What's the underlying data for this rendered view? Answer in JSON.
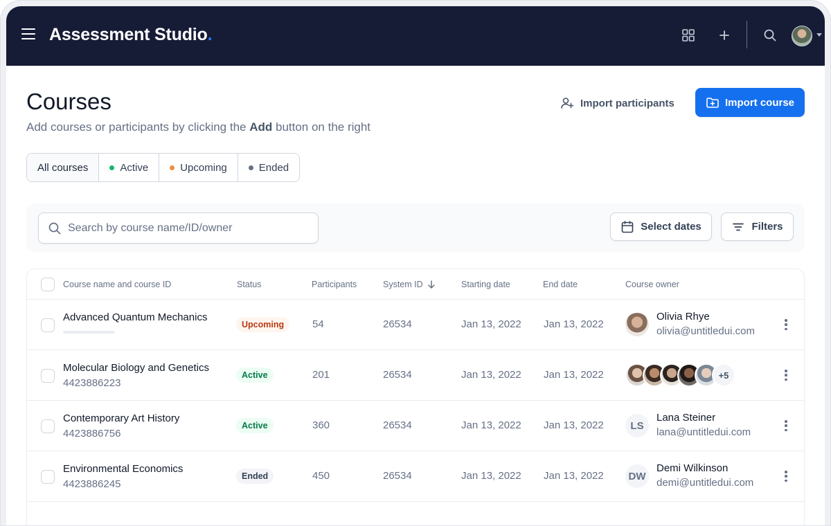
{
  "app": {
    "title": "Assessment Studio",
    "title_dot": "."
  },
  "header": {
    "title": "Courses",
    "subtitle_before": "Add courses or participants by clicking the ",
    "subtitle_bold": "Add",
    "subtitle_after": " button on the right",
    "import_participants": "Import participants",
    "import_course": "Import course"
  },
  "segments": [
    {
      "label": "All courses",
      "dot": null
    },
    {
      "label": "Active",
      "dot": "#12b76a"
    },
    {
      "label": "Upcoming",
      "dot": "#ef8c3c"
    },
    {
      "label": "Ended",
      "dot": "#667085"
    }
  ],
  "search": {
    "placeholder": "Search by course name/ID/owner",
    "value": ""
  },
  "filters": {
    "dates_label": "Select dates",
    "filters_label": "Filters"
  },
  "table": {
    "columns": {
      "name": "Course name and course ID",
      "status": "Status",
      "participants": "Participants",
      "system_id": "System ID",
      "start": "Starting date",
      "end": "End date",
      "owner": "Course owner"
    },
    "rows": [
      {
        "name": "Advanced Quantum Mechanics",
        "course_id": "",
        "status": "Upcoming",
        "participants": "54",
        "system_id": "26534",
        "start": "Jan 13, 2022",
        "end": "Jan 13, 2022",
        "owner_name": "Olivia Rhye",
        "owner_email": "olivia@untitledui.com",
        "owner_initials": ""
      },
      {
        "name": "Molecular Biology and Genetics",
        "course_id": "4423886223",
        "status": "Active",
        "participants": "201",
        "system_id": "26534",
        "start": "Jan 13, 2022",
        "end": "Jan 13, 2022",
        "owner_group_more": "+5"
      },
      {
        "name": "Contemporary Art History",
        "course_id": "4423886756",
        "status": "Active",
        "participants": "360",
        "system_id": "26534",
        "start": "Jan 13, 2022",
        "end": "Jan 13, 2022",
        "owner_name": "Lana Steiner",
        "owner_email": "lana@untitledui.com",
        "owner_initials": "LS"
      },
      {
        "name": "Environmental Economics",
        "course_id": "4423886245",
        "status": "Ended",
        "participants": "450",
        "system_id": "26534",
        "start": "Jan 13, 2022",
        "end": "Jan 13, 2022",
        "owner_name": "Demi Wilkinson",
        "owner_email": "demi@untitledui.com",
        "owner_initials": "DW"
      }
    ]
  },
  "colors": {
    "topbar": "#161b36",
    "primary": "#1570ef",
    "accent_dot": "#2e7cf6"
  },
  "icons": [
    "menu-icon",
    "apps-grid-icon",
    "plus-icon",
    "search-icon",
    "user-plus-icon",
    "folder-plus-icon",
    "calendar-icon",
    "filter-lines-icon",
    "arrow-down-icon",
    "more-vertical-icon"
  ]
}
